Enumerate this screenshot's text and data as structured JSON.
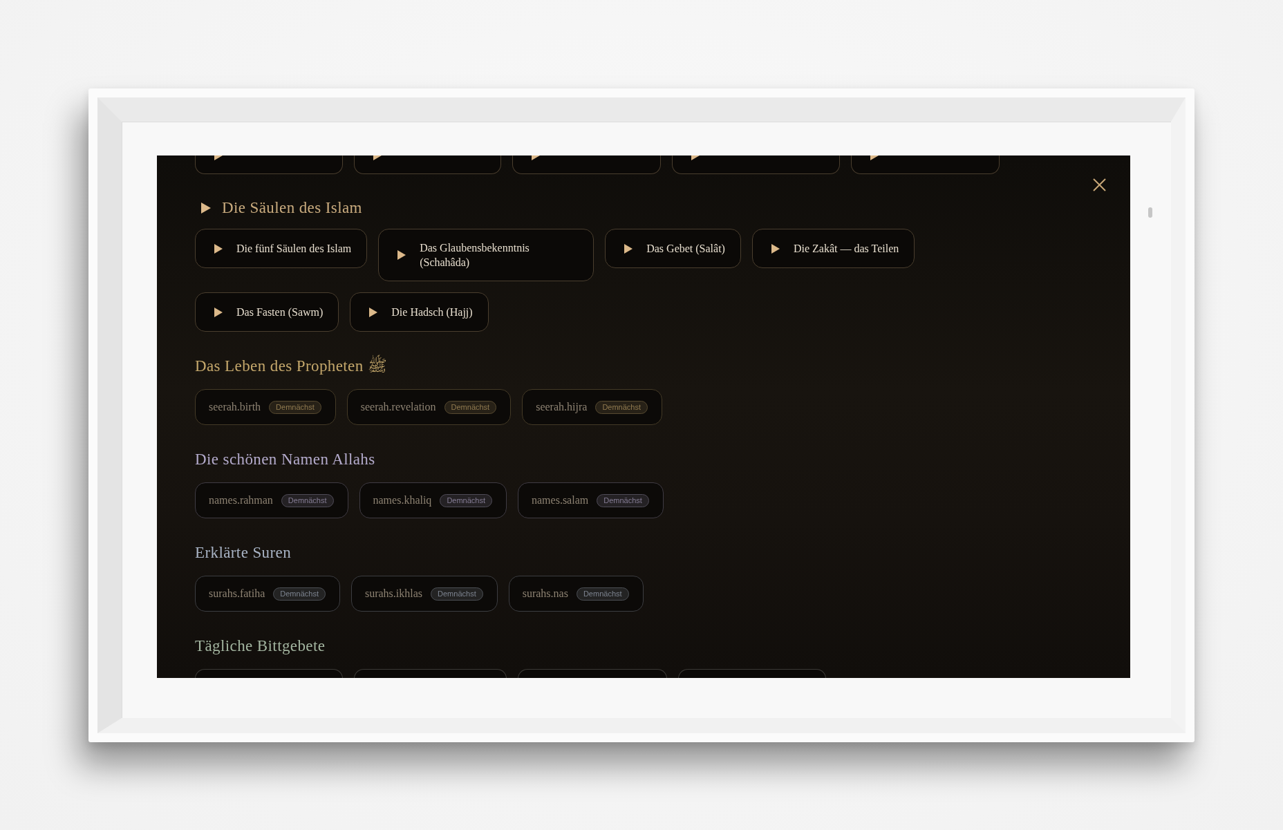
{
  "pillars_section": {
    "title": "Die Säulen des Islam",
    "stories": [
      {
        "title": "Die fünf Säulen des Islam"
      },
      {
        "title": "Das Glaubensbekenntnis (Schahâda)"
      },
      {
        "title": "Das Gebet (Salât)"
      },
      {
        "title": "Die Zakât — das Teilen"
      },
      {
        "title": "Das Fasten (Sawm)"
      },
      {
        "title": "Die Hadsch (Hajj)"
      }
    ]
  },
  "categories": [
    {
      "title": "Das Leben des Propheten ﷺ",
      "color": "#c4a76b",
      "items": [
        {
          "key": "seerah.birth",
          "badge": "Demnächst"
        },
        {
          "key": "seerah.revelation",
          "badge": "Demnächst"
        },
        {
          "key": "seerah.hijra",
          "badge": "Demnächst"
        }
      ]
    },
    {
      "title": "Die schönen Namen Allahs",
      "color": "#b3aacb",
      "items": [
        {
          "key": "names.rahman",
          "badge": "Demnächst"
        },
        {
          "key": "names.khaliq",
          "badge": "Demnächst"
        },
        {
          "key": "names.salam",
          "badge": "Demnächst"
        }
      ]
    },
    {
      "title": "Erklärte Suren",
      "color": "#a8b3c4",
      "items": [
        {
          "key": "surahs.fatiha",
          "badge": "Demnächst"
        },
        {
          "key": "surahs.ikhlas",
          "badge": "Demnächst"
        },
        {
          "key": "surahs.nas",
          "badge": "Demnächst"
        }
      ]
    },
    {
      "title": "Tägliche Bittgebete",
      "color": "#a3b5a0"
    }
  ]
}
